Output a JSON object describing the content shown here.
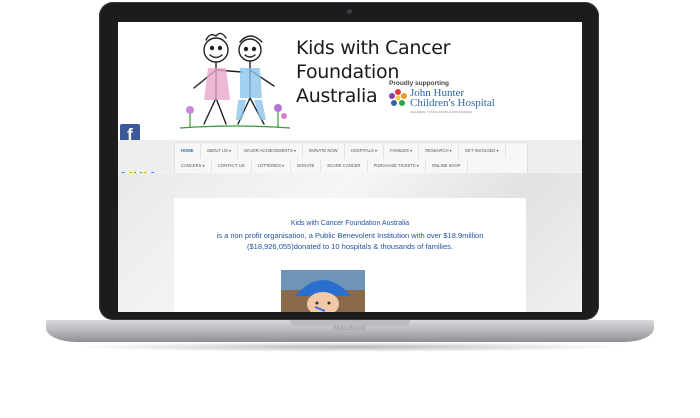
{
  "device": {
    "brand_label": "MacBook"
  },
  "site": {
    "title_line1": "Kids with Cancer Foundation",
    "title_line2": "Australia",
    "supporting_label": "Proudly supporting",
    "hospital_name_line1": "John Hunter",
    "hospital_name_line2": "Children's Hospital",
    "hospital_tagline": "CHILDREN, YOUNG PEOPLE AND FAMILIES"
  },
  "social": {
    "facebook_glyph": "f"
  },
  "nav": {
    "row1": [
      {
        "label": "HOME",
        "active": true
      },
      {
        "label": "ABOUT US ▾"
      },
      {
        "label": "MAJOR ACHIEVEMENTS ▾"
      },
      {
        "label": "DONATE NOW"
      },
      {
        "label": "HOSPITALS ▾"
      },
      {
        "label": "FAMILIES ▾"
      },
      {
        "label": "RESEARCH ▾"
      },
      {
        "label": "GET INVOLVED ▾"
      }
    ],
    "row2": [
      {
        "label": "CANCERS ▾"
      },
      {
        "label": "CONTACT US"
      },
      {
        "label": "LOTTERIES ▾"
      },
      {
        "label": "DONATE"
      },
      {
        "label": "SCARE CANCER"
      },
      {
        "label": "PURCHASE TICKETS ▾"
      },
      {
        "label": "ONLINE SHOP"
      }
    ]
  },
  "content": {
    "heading": "Kids with Cancer Foundation Australia",
    "line1": "is a non profit organisation, a Public Benevolent Institution with over $18.9million",
    "line2": "($18,926,055)donated to 10 hospitals & thousands of families."
  },
  "colors": {
    "accent": "#2f6fb5",
    "text_blue": "#2452a0",
    "facebook": "#3b5998"
  },
  "icons": [
    "facebook-icon",
    "registered-charity-badge-icon",
    "kids-logo-icon",
    "hospital-logo-icon"
  ]
}
